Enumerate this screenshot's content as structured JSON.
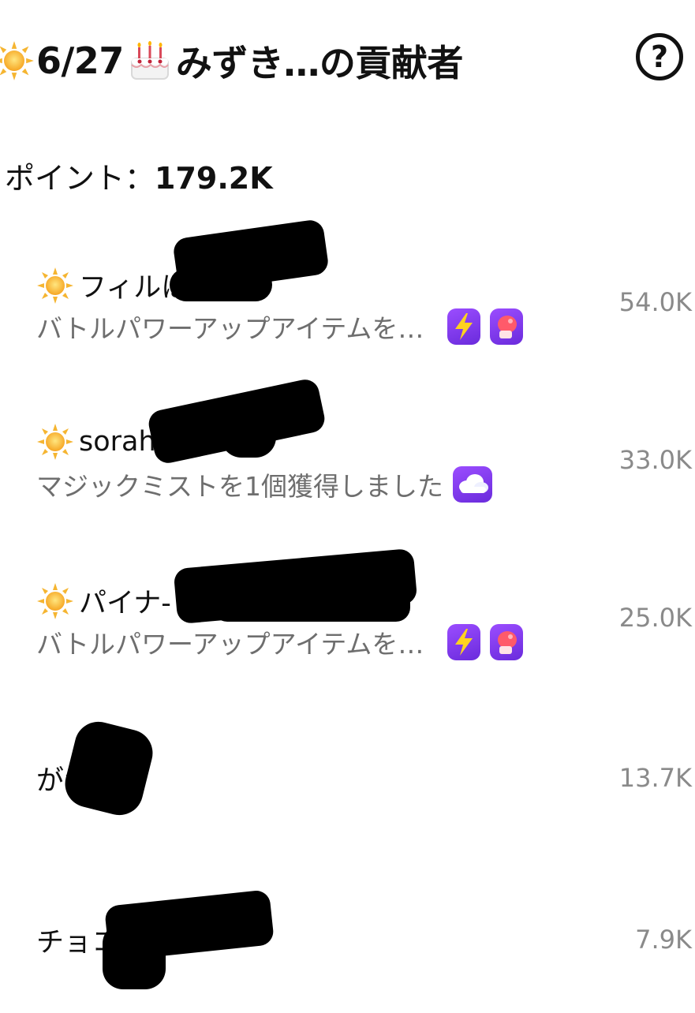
{
  "header": {
    "prefix_icon": "sun-icon",
    "date": "6/27",
    "cake_icon": "birthday-cake-icon",
    "title_text": "みずき…の貢献者",
    "help_icon": "question-circle-icon",
    "help_label": "?"
  },
  "points": {
    "label": "ポイント：",
    "value": "179.2K"
  },
  "contributors": [
    {
      "name": "フィルは",
      "activity": "バトルパワーアップアイテムを…",
      "score": "54.0K",
      "badges": [
        "lightning-gift-icon",
        "boxing-glove-gift-icon"
      ]
    },
    {
      "name": "sorahana",
      "activity": "マジックミストを1個獲得しました",
      "score": "33.0K",
      "badges": [
        "cloud-gift-icon"
      ]
    },
    {
      "name": "パイナ-",
      "activity": "バトルパワーアップアイテムを…",
      "score": "25.0K",
      "badges": [
        "lightning-gift-icon",
        "boxing-glove-gift-icon"
      ]
    },
    {
      "name": "がつ",
      "activity": "",
      "score": "13.7K",
      "badges": []
    },
    {
      "name": "チョコ",
      "activity": "",
      "score": "7.9K",
      "badges": []
    }
  ],
  "colors": {
    "gift_bg": "#7b3cf0",
    "score_text": "#8a8a8a",
    "activity_text": "#6e6e6e"
  }
}
